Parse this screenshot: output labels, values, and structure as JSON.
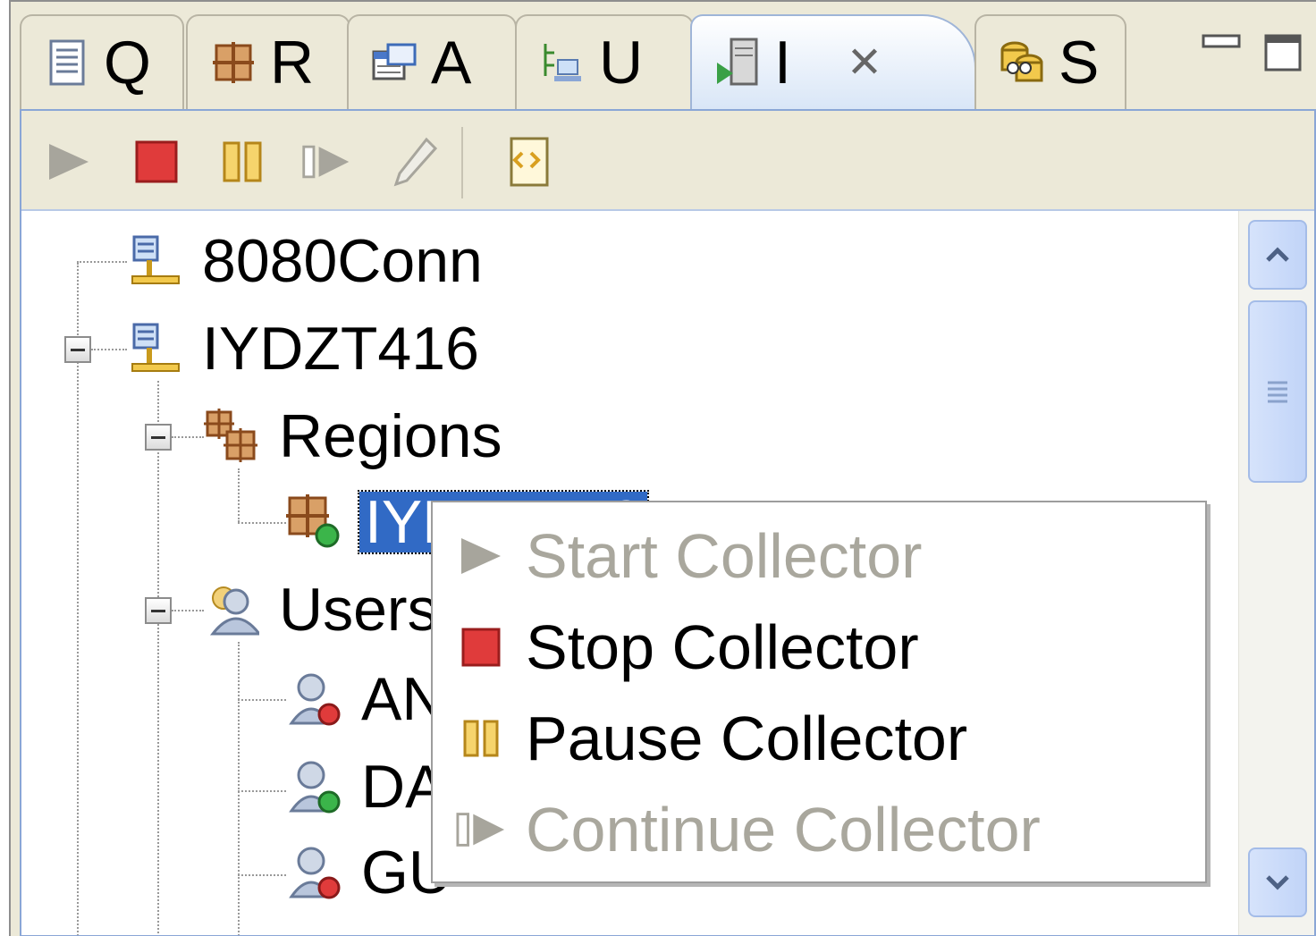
{
  "tabs": [
    {
      "label": "Q",
      "icon": "document-icon"
    },
    {
      "label": "R",
      "icon": "regions-icon"
    },
    {
      "label": "A",
      "icon": "table-window-icon"
    },
    {
      "label": "U",
      "icon": "users-tree-icon"
    },
    {
      "label": "I",
      "icon": "server-run-icon",
      "active": true,
      "close": "✕"
    },
    {
      "label": "S",
      "icon": "database-group-icon"
    }
  ],
  "toolbar": {
    "items": [
      "start-icon",
      "stop-icon",
      "pause-icon",
      "continue-icon",
      "edit-pencil-icon",
      "script-icon"
    ]
  },
  "tree": {
    "nodes": [
      {
        "label": "8080Conn"
      },
      {
        "label": "IYDZT416"
      },
      {
        "label": "Regions"
      },
      {
        "label": "IYDZT416"
      },
      {
        "label": "Users"
      },
      {
        "label": "AN"
      },
      {
        "label": "DA"
      },
      {
        "label": "GU"
      }
    ]
  },
  "context_menu": {
    "items": [
      {
        "label": "Start Collector",
        "enabled": false
      },
      {
        "label": "Stop Collector",
        "enabled": true
      },
      {
        "label": "Pause Collector",
        "enabled": true
      },
      {
        "label": "Continue Collector",
        "enabled": false
      }
    ]
  },
  "colors": {
    "selection": "#316ac5",
    "stop_red": "#e03b3b",
    "pause_gold": "#e0b23a",
    "disabled_text": "#a9a79d"
  }
}
